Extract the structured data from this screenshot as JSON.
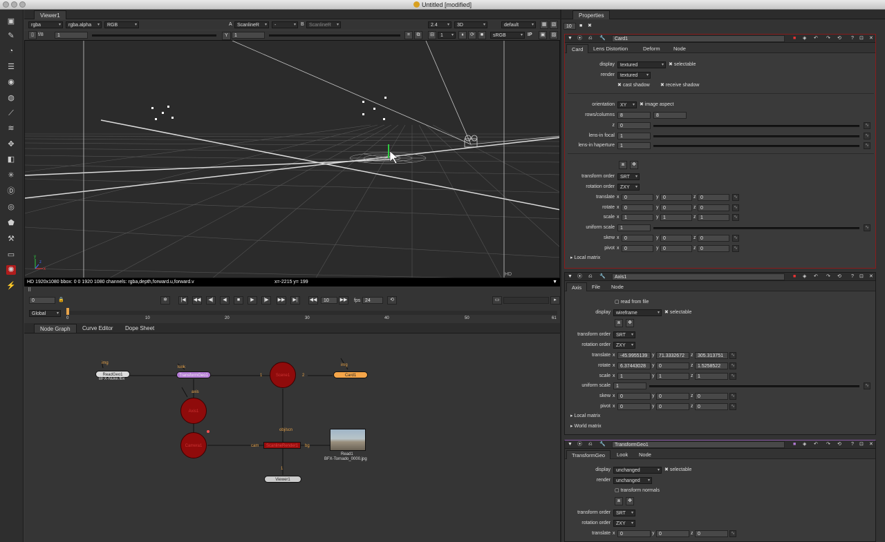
{
  "window": {
    "title": "Untitled [modified]"
  },
  "viewer": {
    "tab": "Viewer1",
    "channels": "rgba",
    "alpha": "rgba.alpha",
    "display_channels": "RGB",
    "input_a_label": "A",
    "input_a": "ScanlineR",
    "wipe": "-",
    "input_b_label": "B",
    "input_b": "ScanlineR",
    "zoom": "2.4",
    "view_mode": "3D",
    "lut_default": "default",
    "fstop": "f/8",
    "gain": "1",
    "gamma_label": "Y",
    "gamma": "1",
    "frame": "1",
    "lut": "sRGB",
    "ip_label": "IP",
    "info": "HD 1920x1080 bbox: 0 0 1920 1080 channels: rgba,depth,forward.u,forward.v",
    "coords": "x=-2215 y= 199",
    "format": "HD"
  },
  "timeline": {
    "frame": "0",
    "increment": "10",
    "fps_label": "fps",
    "fps": "24",
    "range": "Global",
    "ticks": [
      "0",
      "10",
      "20",
      "30",
      "40",
      "50",
      "61"
    ]
  },
  "graph": {
    "tabs": [
      "Node Graph",
      "Curve Editor",
      "Dope Sheet"
    ],
    "nodes": {
      "read_geo": "ReadGeo1",
      "read_geo_file": "BFX-Nuke.fbx",
      "transform_geo": "TransformGeo1",
      "scene": "Scene1",
      "card": "Card1",
      "axis": "Axis1",
      "camera": "Camera1",
      "scanline": "ScanlineRender1",
      "read": "Read1",
      "read_file": "BFX-Tornado_0000.jpg",
      "viewer": "Viewer1"
    },
    "pipes": {
      "img1": "img",
      "look": "look",
      "img2": "img",
      "axis": "axis",
      "one": "1",
      "two": "2",
      "obj": "obj/scn",
      "cam": "cam",
      "bg": "bg",
      "vone": "1"
    }
  },
  "properties": {
    "tab": "Properties",
    "max_panels": "10",
    "card": {
      "name": "Card1",
      "tabs": [
        "Card",
        "Lens Distortion",
        "Deform",
        "Node"
      ],
      "display_label": "display",
      "display": "textured",
      "selectable": "selectable",
      "render_label": "render",
      "render": "textured",
      "cast_shadow": "cast shadow",
      "receive_shadow": "receive shadow",
      "orientation_label": "orientation",
      "orientation": "XY",
      "image_aspect": "image aspect",
      "rows_label": "rows/columns",
      "rows": "8",
      "columns": "8",
      "z_label": "z",
      "z": "0",
      "focal_label": "lens-in focal",
      "focal": "1",
      "haperture_label": "lens-in haperture",
      "haperture": "1",
      "transform_order_label": "transform order",
      "transform_order": "SRT",
      "rotation_order_label": "rotation order",
      "rotation_order": "ZXY",
      "translate_label": "translate",
      "translate": [
        "0",
        "0",
        "0"
      ],
      "rotate_label": "rotate",
      "rotate": [
        "0",
        "0",
        "0"
      ],
      "scale_label": "scale",
      "scale": [
        "1",
        "1",
        "1"
      ],
      "uniform_label": "uniform scale",
      "uniform": "1",
      "skew_label": "skew",
      "skew": [
        "0",
        "0",
        "0"
      ],
      "pivot_label": "pivot",
      "pivot": [
        "0",
        "0",
        "0"
      ],
      "local_matrix": "Local matrix"
    },
    "axis": {
      "name": "Axis1",
      "tabs": [
        "Axis",
        "File",
        "Node"
      ],
      "read_from_file": "read from file",
      "display_label": "display",
      "display": "wireframe",
      "selectable": "selectable",
      "transform_order_label": "transform order",
      "transform_order": "SRT",
      "rotation_order_label": "rotation order",
      "rotation_order": "ZXY",
      "translate_label": "translate",
      "translate": [
        "-45.9955139",
        "71.3332672",
        "305.313751"
      ],
      "rotate_label": "rotate",
      "rotate": [
        "6.37443028",
        "0",
        "1.5258522"
      ],
      "scale_label": "scale",
      "scale": [
        "1",
        "1",
        "1"
      ],
      "uniform_label": "uniform scale",
      "uniform": "1",
      "skew_label": "skew",
      "skew": [
        "0",
        "0",
        "0"
      ],
      "pivot_label": "pivot",
      "pivot": [
        "0",
        "0",
        "0"
      ],
      "local_matrix": "Local matrix",
      "world_matrix": "World matrix"
    },
    "tgeo": {
      "name": "TransformGeo1",
      "tabs": [
        "TransformGeo",
        "Look",
        "Node"
      ],
      "display_label": "display",
      "display": "unchanged",
      "selectable": "selectable",
      "render_label": "render",
      "render": "unchanged",
      "transform_normals": "transform normals",
      "transform_order_label": "transform order",
      "transform_order": "SRT",
      "rotation_order_label": "rotation order",
      "rotation_order": "ZXY",
      "translate_label": "translate",
      "translate": [
        "0",
        "0",
        "0"
      ]
    }
  },
  "axis_labels": {
    "x": "x",
    "y": "y",
    "z": "z"
  }
}
